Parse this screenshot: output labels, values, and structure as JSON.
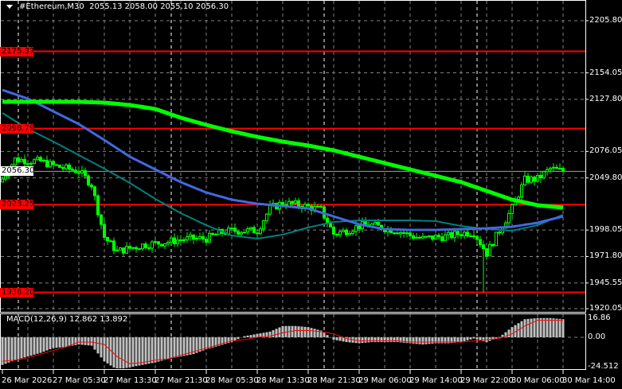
{
  "header": {
    "symbol": "#Ethereum,M30",
    "ohlc": "2055.13 2058.00 2055.10 2056.30"
  },
  "macd_label": "MACD(12,26,9) 12.862 13.892",
  "colors": {
    "background": "#000000",
    "candle": "#00ff00",
    "level_line": "#ff0000",
    "ma_slow": "#00ff00",
    "ma_mid": "#4169e1",
    "ma_fast": "#008080",
    "macd_histogram": "#c0c0c0",
    "macd_signal": "#ff0000",
    "grid": "#808080"
  },
  "chart_data": [
    {
      "type": "candlestick",
      "timeframe": "M30",
      "ylim": [
        1920.05,
        2205.8
      ],
      "grid": true,
      "y_ticks": [
        "2205.80",
        "2154.05",
        "2127.80",
        "2076.05",
        "2049.80",
        "1998.05",
        "1971.80",
        "1945.55",
        "1920.05"
      ],
      "y_tick_values": [
        2205.8,
        2154.05,
        2127.8,
        2076.05,
        2049.8,
        1998.05,
        1971.8,
        1945.55,
        1920.05
      ],
      "x_ticks": [
        "26 Mar 2026",
        "27 Mar 05:30",
        "27 Mar 13:30",
        "27 Mar 21:30",
        "28 Mar 05:30",
        "28 Mar 13:30",
        "28 Mar 21:30",
        "29 Mar 06:00",
        "29 Mar 14:00",
        "29 Mar 22:00",
        "30 Mar 06:00",
        "30 Mar 14:00"
      ],
      "close_every_4_bars": [
        2048.7,
        2068.4,
        2066.9,
        2066.1,
        2062.1,
        2059.0,
        2056.6,
        2043.2,
        1991.1,
        1976.9,
        1980.0,
        1983.2,
        1984.8,
        1986.4,
        1988.7,
        1989.5,
        1989.5,
        1995.0,
        1997.4,
        1997.4,
        1997.4,
        2019.5,
        2025.0,
        2023.4,
        2021.1,
        2017.9,
        1994.2,
        1997.4,
        2002.1,
        2002.9,
        1999.8,
        1997.4,
        1992.7,
        1989.5,
        1991.1,
        1991.9,
        1995.0,
        1995.8,
        1975.3,
        1997.4,
        2019.5,
        2047.9,
        2048.7,
        2059.0,
        2056.3
      ],
      "spike_low": 1936.2,
      "current_price": 2056.3,
      "current_price_label": "2056.30",
      "levels": [
        {
          "value": 2175.37,
          "label": "2175.37"
        },
        {
          "value": 2098.79,
          "label": "2098.79"
        },
        {
          "value": 2023.25,
          "label": "2023.25"
        },
        {
          "value": 1936.2,
          "label": "1936.20"
        }
      ],
      "moving_averages_every_8_bars": {
        "ma_slow": [
          2125.3,
          2125.3,
          2125.3,
          2125.3,
          2124.5,
          2122.1,
          2118.2,
          2109.5,
          2102.4,
          2096.1,
          2090.5,
          2085.8,
          2081.9,
          2077.1,
          2070.8,
          2064.5,
          2058.2,
          2051.9,
          2045.6,
          2036.9,
          2028.2,
          2022.7,
          2020.3
        ],
        "ma_mid": [
          2137.1,
          2128.4,
          2115.8,
          2103.2,
          2087.4,
          2070.8,
          2058.2,
          2045.6,
          2035.3,
          2028.2,
          2024.2,
          2021.9,
          2019.5,
          2011.6,
          2003.7,
          1999.0,
          1998.2,
          1998.2,
          1999.0,
          1999.8,
          2001.3,
          2005.3,
          2011.6
        ],
        "ma_fast": [
          2114.2,
          2098.4,
          2085.8,
          2072.4,
          2059.0,
          2044.8,
          2029.0,
          2014.8,
          2002.9,
          1992.7,
          1989.5,
          1993.5,
          2000.6,
          2006.1,
          2007.7,
          2007.7,
          2007.7,
          2006.9,
          2002.1,
          1999.0,
          1997.4,
          2002.9,
          2013.2
        ]
      }
    },
    {
      "type": "bar+line",
      "name": "MACD(12,26,9)",
      "ylim": [
        -24.512,
        16.86
      ],
      "y_ticks": [
        "16.86",
        "0.00",
        "-24.512"
      ],
      "y_tick_values": [
        16.86,
        0,
        -24.512
      ],
      "macd_every_4_bars": [
        -23,
        -19,
        -16,
        -13,
        -9,
        -8,
        -6,
        -7,
        -20,
        -27,
        -25,
        -23,
        -21,
        -18,
        -16,
        -14,
        -10,
        -7,
        -4,
        1,
        3,
        5,
        10,
        10,
        9,
        6,
        -2,
        -4,
        -5,
        -4,
        -4,
        -4,
        -5,
        -6,
        -5,
        -5,
        -4,
        -1,
        -4,
        0,
        9,
        16,
        17,
        17,
        16
      ],
      "signal_every_4_bars": [
        -20,
        -19,
        -17,
        -14,
        -11,
        -8,
        -4,
        -4,
        -6,
        -16,
        -22,
        -21,
        -19,
        -18,
        -15,
        -12,
        -9,
        -6,
        -3,
        -2,
        0,
        1,
        4,
        6,
        6,
        5,
        3,
        -1,
        -3,
        -3,
        -3,
        -3,
        -4,
        -4,
        -4,
        -4,
        -4,
        -3,
        -2,
        -1,
        3,
        10,
        15,
        15,
        15
      ]
    }
  ]
}
